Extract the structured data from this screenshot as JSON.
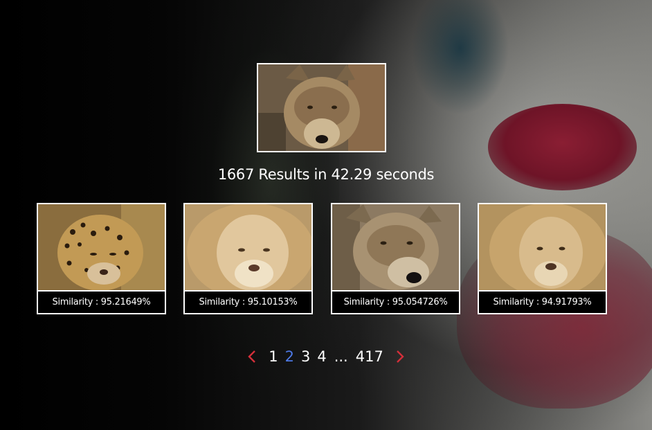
{
  "query": {
    "animal": "wolf",
    "alt": "Query image"
  },
  "results_text": "1667 Results in 42.29 seconds",
  "results": [
    {
      "animal": "leopard",
      "caption": "Similarity : 95.21649%"
    },
    {
      "animal": "lion",
      "caption": "Similarity : 95.10153%"
    },
    {
      "animal": "wolf",
      "caption": "Similarity : 95.054726%"
    },
    {
      "animal": "lion",
      "caption": "Similarity : 94.91793%"
    }
  ],
  "pagination": {
    "prev_icon": "chevron-left-icon",
    "next_icon": "chevron-right-icon",
    "arrow_color": "#d32f3a",
    "active_color": "#4d79e6",
    "pages": [
      "1",
      "2",
      "3",
      "4"
    ],
    "active_page": "2",
    "ellipsis": "...",
    "last_page": "417"
  }
}
